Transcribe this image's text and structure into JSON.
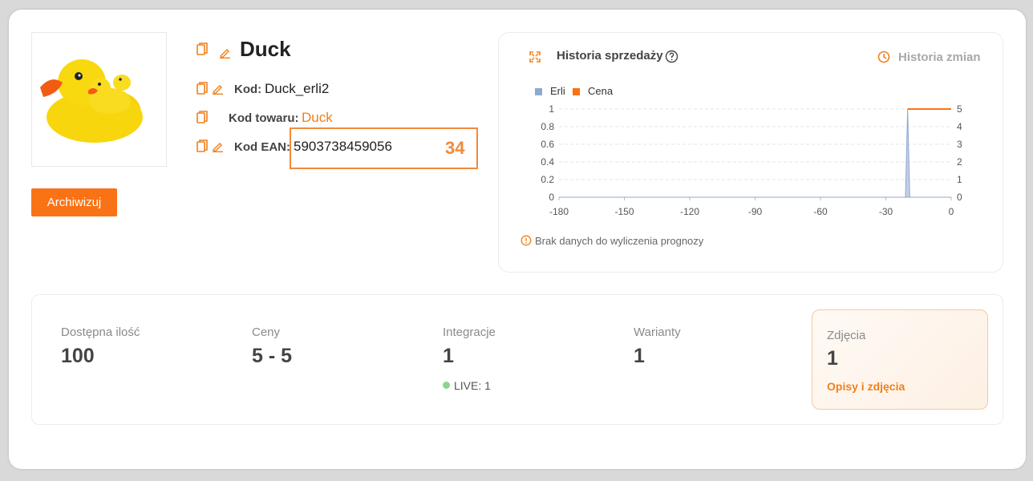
{
  "product": {
    "image_alt": "Duck",
    "title": "Duck",
    "archive_label": "Archiwizuj",
    "code_label": "Kod:",
    "code_value": "Duck_erli2",
    "item_code_label": "Kod towaru:",
    "item_code_value": "Duck",
    "ean_label": "Kod EAN:",
    "ean_value": "5903738459056",
    "ean_badge": "34"
  },
  "sales_history": {
    "title": "Historia sprzedaży",
    "change_history_label": "Historia zmian",
    "no_data_note": "Brak danych do wyliczenia prognozy"
  },
  "chart_data": {
    "type": "line",
    "title": "",
    "series": [
      {
        "name": "Erli",
        "type": "area",
        "axis": "left",
        "color": "#8fa8d0",
        "x": [
          -180,
          -21,
          -20,
          -19,
          0
        ],
        "values": [
          0,
          0,
          1,
          0,
          0
        ]
      },
      {
        "name": "Cena",
        "type": "line",
        "axis": "right",
        "color": "#f97316",
        "x": [
          -20,
          0
        ],
        "values": [
          5,
          5
        ]
      }
    ],
    "x_ticks": [
      "-180",
      "-150",
      "-120",
      "-90",
      "-60",
      "-30",
      "0"
    ],
    "y_left_ticks": [
      "0",
      "0.2",
      "0.4",
      "0.6",
      "0.8",
      "1"
    ],
    "y_right_ticks": [
      "0",
      "1",
      "2",
      "3",
      "4",
      "5"
    ],
    "xlim": [
      -180,
      0
    ],
    "ylim_left": [
      0,
      1
    ],
    "ylim_right": [
      0,
      5
    ],
    "grid": true,
    "legend": "top-left"
  },
  "stats": [
    {
      "label": "Dostępna ilość",
      "value": "100"
    },
    {
      "label": "Ceny",
      "value": "5 - 5"
    },
    {
      "label": "Integracje",
      "value": "1",
      "sub": "LIVE: 1"
    },
    {
      "label": "Warianty",
      "value": "1"
    }
  ],
  "photos": {
    "label": "Zdjęcia",
    "value": "1",
    "link": "Opisy i zdjęcia"
  },
  "colors": {
    "accent": "#f97316",
    "link": "#f08019",
    "highlight_box": "#f08a3a",
    "live": "#86d98a"
  }
}
